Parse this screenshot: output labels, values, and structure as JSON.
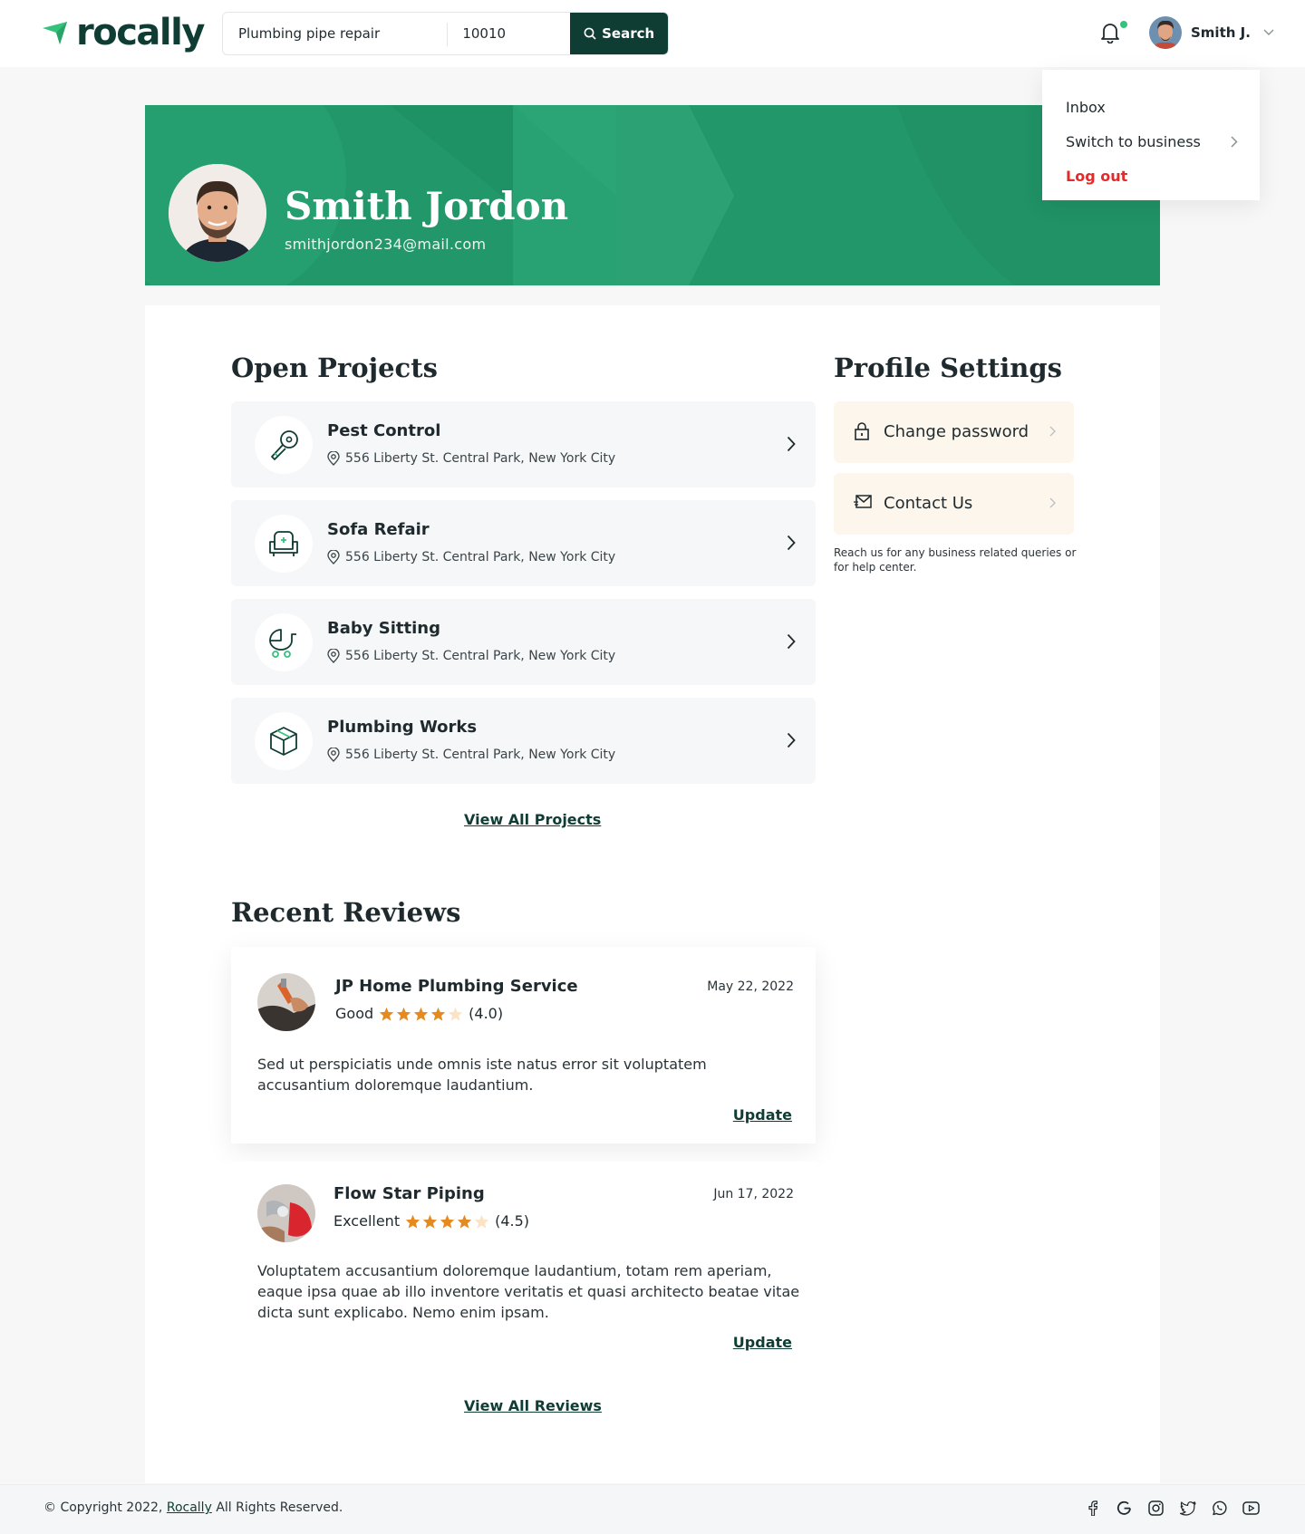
{
  "brand": {
    "name": "rocally",
    "accent": "#35c27c",
    "dark": "#0f3d34",
    "banner": "#22976a"
  },
  "search": {
    "query_value": "Plumbing pipe repair",
    "zip_value": "10010",
    "button_label": "Search"
  },
  "header": {
    "user_name": "Smith J."
  },
  "user_menu": {
    "items": [
      {
        "label": "Inbox"
      },
      {
        "label": "Switch to business"
      },
      {
        "label": "Log out"
      }
    ]
  },
  "profile": {
    "name": "Smith Jordon",
    "email": "smithjordon234@mail.com"
  },
  "open_projects": {
    "title": "Open Projects",
    "items": [
      {
        "title": "Pest Control",
        "address": "556 Liberty St. Central Park, New York City",
        "icon": "pest-control-icon"
      },
      {
        "title": "Sofa Refair",
        "address": "556 Liberty St. Central Park, New York City",
        "icon": "sofa-icon"
      },
      {
        "title": "Baby Sitting",
        "address": "556 Liberty St. Central Park, New York City",
        "icon": "stroller-icon"
      },
      {
        "title": "Plumbing Works",
        "address": "556 Liberty St. Central Park, New York City",
        "icon": "box-icon"
      }
    ],
    "view_all": "View All Projects"
  },
  "profile_settings": {
    "title": "Profile Settings",
    "items": [
      {
        "label": "Change password",
        "icon": "lock-icon"
      },
      {
        "label": "Contact Us",
        "icon": "mail-icon"
      }
    ],
    "help_text": "Reach us for any business related queries or for help center."
  },
  "recent_reviews": {
    "title": "Recent Reviews",
    "items": [
      {
        "company": "JP Home Plumbing Service",
        "date": "May 22, 2022",
        "rating_word": "Good",
        "rating": 4.0,
        "rating_text": "(4.0)",
        "text": "Sed ut perspiciatis unde omnis iste natus error sit voluptatem accusantium doloremque laudantium.",
        "action": "Update"
      },
      {
        "company": "Flow Star Piping",
        "date": "Jun 17, 2022",
        "rating_word": "Excellent",
        "rating": 4.5,
        "rating_text": "(4.5)",
        "text": "Voluptatem accusantium doloremque laudantium, totam rem aperiam, eaque ipsa quae ab illo inventore veritatis et quasi architecto beatae vitae dicta sunt explicabo. Nemo enim ipsam.",
        "action": "Update"
      }
    ],
    "view_all": "View All Reviews"
  },
  "footer": {
    "copyright_prefix": "© Copyright 2022,",
    "brand_link": "Rocally",
    "copyright_suffix": "All Rights Reserved.",
    "socials": [
      "facebook-icon",
      "google-icon",
      "instagram-icon",
      "twitter-icon",
      "whatsapp-icon",
      "youtube-icon"
    ]
  }
}
